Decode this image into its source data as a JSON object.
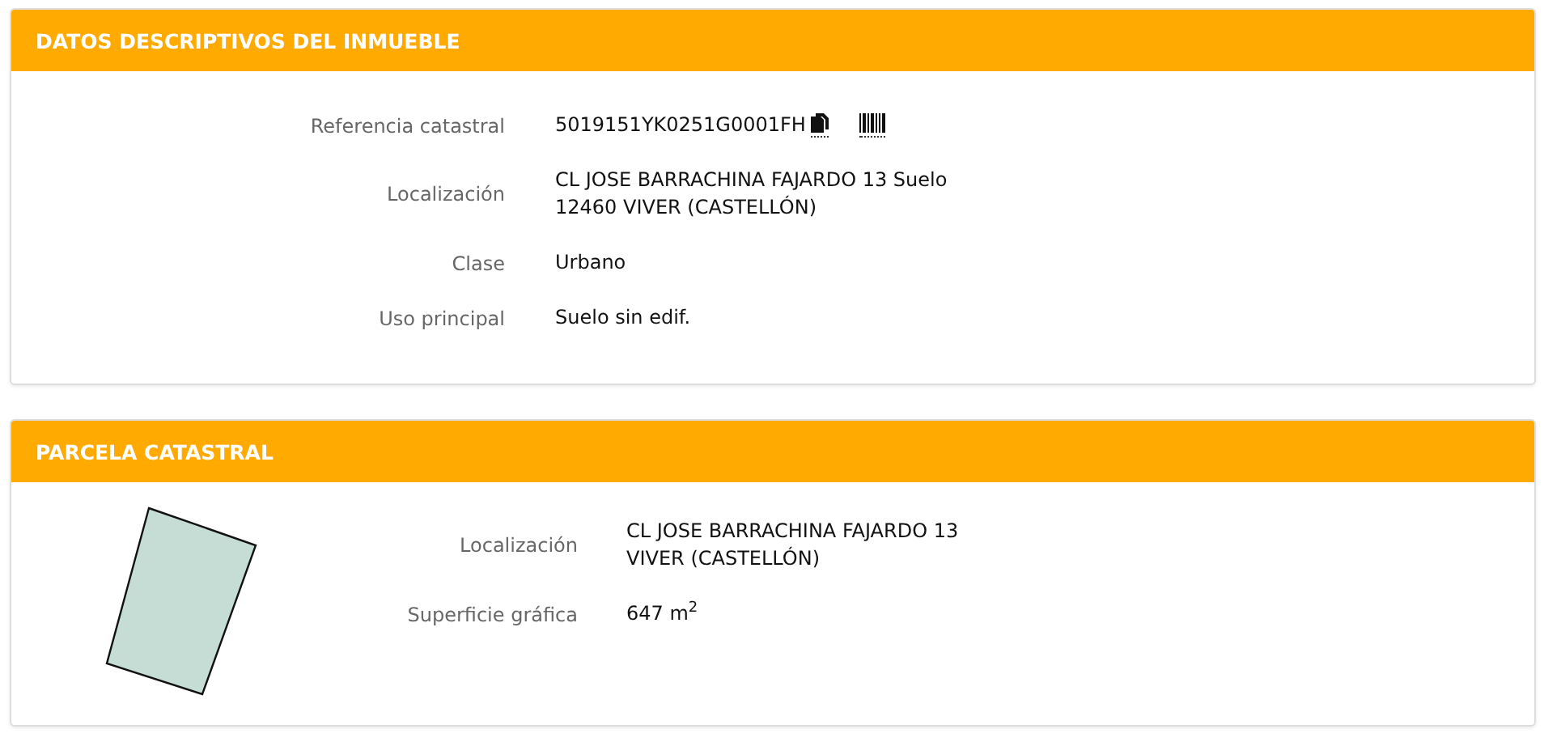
{
  "panels": [
    {
      "title": "DATOS DESCRIPTIVOS DEL INMUEBLE",
      "kind": "fields",
      "rows": [
        {
          "label": "Referencia catastral",
          "lines": [
            "5019151YK0251G0001FH"
          ],
          "kind": "reference"
        },
        {
          "label": "Localización",
          "lines": [
            "CL JOSE BARRACHINA FAJARDO 13 Suelo",
            "12460 VIVER (CASTELLÓN)"
          ],
          "kind": "text"
        },
        {
          "label": "Clase",
          "lines": [
            "Urbano"
          ],
          "kind": "text"
        },
        {
          "label": "Uso principal",
          "lines": [
            "Suelo sin edif."
          ],
          "kind": "text"
        }
      ]
    },
    {
      "title": "PARCELA CATASTRAL",
      "kind": "parcel",
      "rows": [
        {
          "label": "Localización",
          "lines": [
            "CL JOSE BARRACHINA FAJARDO 13",
            "VIVER (CASTELLÓN)"
          ],
          "kind": "text"
        },
        {
          "label": "Superficie gráfica",
          "lines": [
            "647 m$^{2}$"
          ],
          "kind": "text"
        }
      ]
    }
  ]
}
